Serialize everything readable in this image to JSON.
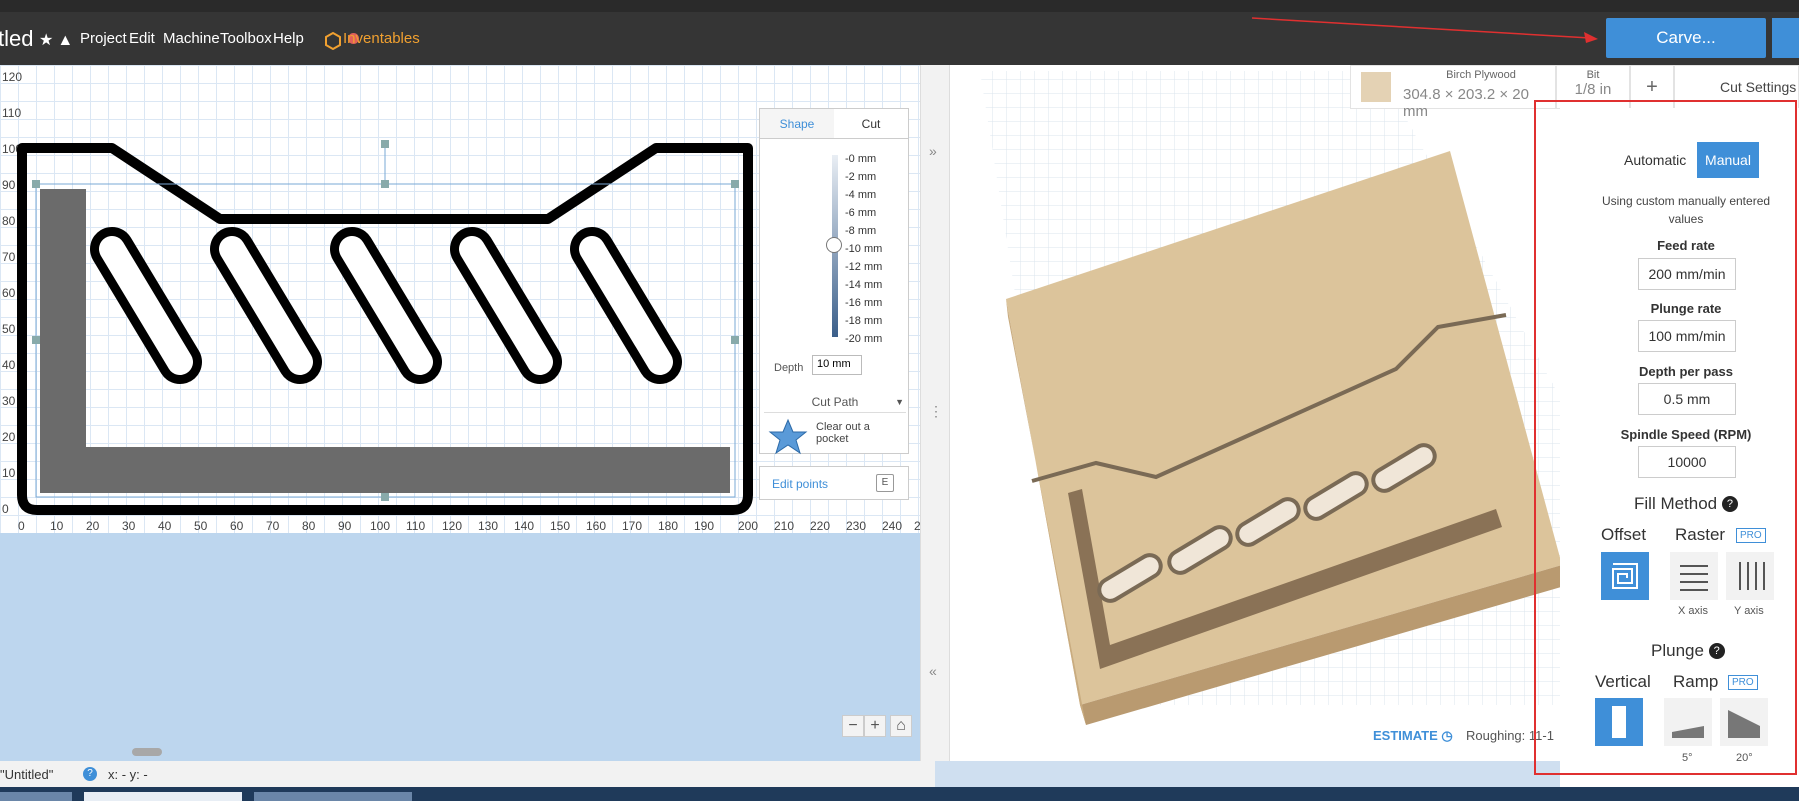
{
  "header": {
    "title": "tled",
    "menu": [
      "Project",
      "Edit",
      "Machine",
      "Toolbox",
      "Help"
    ],
    "inventables": "Inventables",
    "carve_button": "Carve..."
  },
  "ruler": {
    "y_labels": [
      "120",
      "110",
      "100",
      "90",
      "80",
      "70",
      "60",
      "50",
      "40",
      "30",
      "20",
      "10",
      "0"
    ],
    "x_labels": [
      "0",
      "10",
      "20",
      "30",
      "40",
      "50",
      "60",
      "70",
      "80",
      "90",
      "100",
      "110",
      "120",
      "130",
      "140",
      "150",
      "160",
      "170",
      "180",
      "190",
      "200",
      "210",
      "220",
      "230",
      "240",
      "2"
    ]
  },
  "cut_panel": {
    "tabs": [
      "Shape",
      "Cut"
    ],
    "active_tab": "Cut",
    "depth_ticks": [
      "-0 mm",
      "-2 mm",
      "-4 mm",
      "-6 mm",
      "-8 mm",
      "-10 mm",
      "-12 mm",
      "-14 mm",
      "-16 mm",
      "-18 mm",
      "-20 mm"
    ],
    "depth_label": "Depth",
    "depth_value": "10 mm",
    "cut_path_label": "Cut Path",
    "cut_type": "Clear out a pocket",
    "edit_points": "Edit points",
    "edit_points_key": "E"
  },
  "material": {
    "name": "Birch Plywood",
    "size": "304.8 × 203.2 × 20 mm"
  },
  "bit": {
    "label": "Bit",
    "value": "1/8 in"
  },
  "plus": "+",
  "cut_settings": {
    "title": "Cut Settings",
    "mode_automatic": "Automatic",
    "mode_manual": "Manual",
    "note": "Using custom manually entered values",
    "feed_rate_label": "Feed rate",
    "feed_rate": "200 mm/min",
    "plunge_rate_label": "Plunge rate",
    "plunge_rate": "100 mm/min",
    "depth_per_pass_label": "Depth per pass",
    "depth_per_pass": "0.5 mm",
    "spindle_label": "Spindle Speed (RPM)",
    "spindle": "10000",
    "fill_method_label": "Fill Method",
    "fill_offset": "Offset",
    "fill_raster": "Raster",
    "pro": "PRO",
    "x_axis": "X axis",
    "y_axis": "Y axis",
    "plunge_label": "Plunge",
    "plunge_vertical": "Vertical",
    "plunge_ramp": "Ramp",
    "ramp_5": "5°",
    "ramp_20": "20°"
  },
  "estimate": {
    "label": "ESTIMATE",
    "roughing": "Roughing: 11-1"
  },
  "status": {
    "name": "\"Untitled\"",
    "coords": "x: - y: -"
  },
  "colors": {
    "accent": "#3f8fd8",
    "highlight_box": "#e03030",
    "wood": "#e4d2b4"
  }
}
